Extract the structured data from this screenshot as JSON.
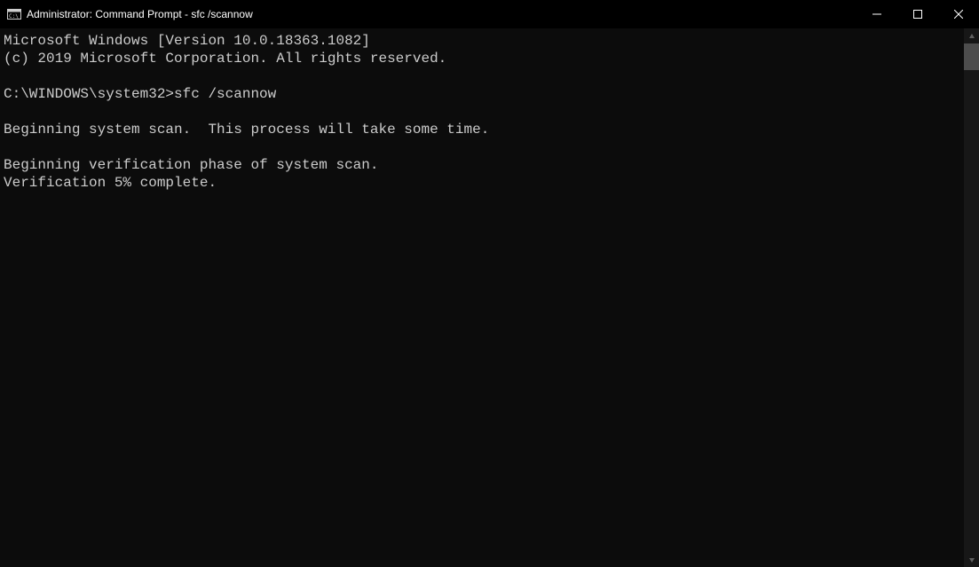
{
  "titlebar": {
    "title": "Administrator: Command Prompt - sfc  /scannow"
  },
  "terminal": {
    "version_text": "Microsoft Windows [Version 10.0.18363.1082]",
    "copyright_text": "(c) 2019 Microsoft Corporation. All rights reserved.",
    "prompt_path": "C:\\WINDOWS\\system32>",
    "command": "sfc /scannow",
    "scan_start": "Beginning system scan.  This process will take some time.",
    "verification_start": "Beginning verification phase of system scan.",
    "verification_progress": "Verification 5% complete."
  }
}
